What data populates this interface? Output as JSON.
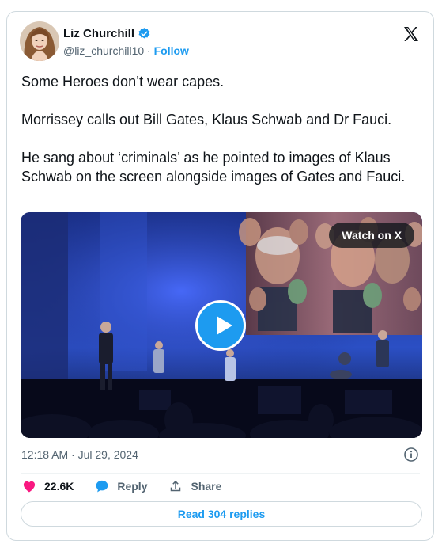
{
  "author": {
    "name": "Liz Churchill",
    "handle": "@liz_churchill10",
    "separator": "·",
    "follow_label": "Follow"
  },
  "tweet": {
    "paragraphs": [
      "Some Heroes don’t wear capes.",
      "Morrissey calls out Bill Gates, Klaus Schwab and Dr Fauci.",
      "He sang about ‘criminals’ as he pointed to images of Klaus Schwab on the screen alongside images of Gates and Fauci."
    ]
  },
  "media": {
    "watch_label": "Watch on X"
  },
  "timestamp": "12:18 AM · Jul 29, 2024",
  "actions": {
    "likes": "22.6K",
    "reply_label": "Reply",
    "share_label": "Share"
  },
  "replies_button": "Read 304 replies",
  "colors": {
    "accent": "#1d9bf0",
    "like": "#f91880",
    "secondary_text": "#536471",
    "border": "#cfd9de"
  }
}
